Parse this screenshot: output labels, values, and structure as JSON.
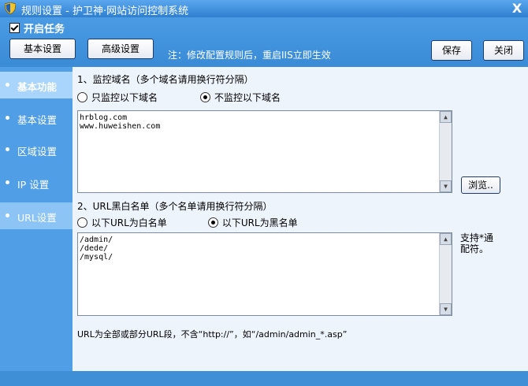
{
  "window": {
    "title": "规则设置 - 护卫神·网站访问控制系统",
    "close_label": "X",
    "app_icon": "shield-icon"
  },
  "toolbar": {
    "enable_task_label": "开启任务",
    "enable_task_checked": true,
    "basic_settings_button": "基本设置",
    "advanced_settings_button": "高级设置",
    "note": "注：修改配置规则后，重启IIS立即生效",
    "save_button": "保存",
    "close_button": "关闭"
  },
  "sidebar": {
    "items": [
      {
        "label": "基本功能",
        "state": "active"
      },
      {
        "label": "基本设置",
        "state": "normal"
      },
      {
        "label": "区域设置",
        "state": "normal"
      },
      {
        "label": "IP 设置",
        "state": "normal"
      },
      {
        "label": "URL设置",
        "state": "highlight"
      }
    ]
  },
  "domain_section": {
    "title": "1、监控域名（多个域名请用换行符分隔）",
    "option_only": "只监控以下域名",
    "option_except": "不监控以下域名",
    "selected": "option_except",
    "domains_text": "hrblog.com\nwww.huweishen.com",
    "browse_button": "浏览.."
  },
  "url_section": {
    "title": "2、URL黑白名单（多个名单请用换行符分隔）",
    "option_whitelist": "以下URL为白名单",
    "option_blacklist": "以下URL为黑名单",
    "selected": "option_blacklist",
    "urls_text": "/admin/\n/dede/\n/mysql/",
    "wildcard_note": "支持*通配符。",
    "bottom_note": "URL为全部或部分URL段，不含“http://”，如“/admin/admin_*.asp”"
  },
  "colors": {
    "window_blue": "#3f8fd6",
    "content_bg": "#eef4fb",
    "sidebar_active": "#a9d4fb"
  }
}
